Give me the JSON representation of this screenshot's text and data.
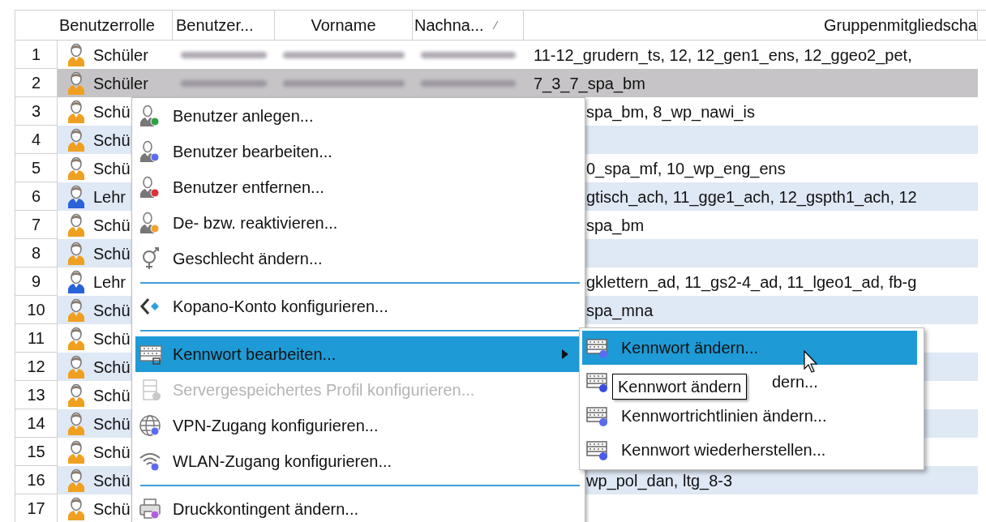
{
  "table": {
    "columns": [
      "Benutzerrolle",
      "Benutzer...",
      "Vorname",
      "Nachna...",
      "Gruppenmitgliedscha"
    ],
    "rows": [
      {
        "number": "1",
        "role": "Schüler",
        "color": "#f0a020",
        "selected": false,
        "redacted": true,
        "groups": "11-12_grudern_ts, 12, 12_gen1_ens, 12_ggeo2_pet,"
      },
      {
        "number": "2",
        "role": "Schüler",
        "color": "#f0a020",
        "selected": true,
        "redacted": true,
        "groups": "7_3_7_spa_bm"
      },
      {
        "number": "3",
        "role": "Schü",
        "color": "#f0a020",
        "selected": false,
        "groups": "spa_bm, 8_wp_nawi_is"
      },
      {
        "number": "4",
        "role": "Schü",
        "color": "#f0a020",
        "selected": false
      },
      {
        "number": "5",
        "role": "Schü",
        "color": "#f0a020",
        "selected": false,
        "groups": "0_spa_mf, 10_wp_eng_ens"
      },
      {
        "number": "6",
        "role": "Lehr",
        "color": "#2a62d8",
        "selected": false,
        "groups": "gtisch_ach, 11_gge1_ach, 12_gspth1_ach, 12"
      },
      {
        "number": "7",
        "role": "Schü",
        "color": "#f0a020",
        "selected": false,
        "groups": "spa_bm"
      },
      {
        "number": "8",
        "role": "Schü",
        "color": "#f0a020",
        "selected": false
      },
      {
        "number": "9",
        "role": "Lehr",
        "color": "#2a62d8",
        "selected": false,
        "groups": "gklettern_ad, 11_gs2-4_ad, 11_lgeo1_ad, fb-g"
      },
      {
        "number": "10",
        "role": "Schü",
        "color": "#f0a020",
        "selected": false,
        "groups": "spa_mna"
      },
      {
        "number": "11",
        "role": "Schü",
        "color": "#f0a020",
        "selected": false
      },
      {
        "number": "12",
        "role": "Schü",
        "color": "#f0a020",
        "selected": false
      },
      {
        "number": "13",
        "role": "Schü",
        "color": "#f0a020",
        "selected": false
      },
      {
        "number": "14",
        "role": "Schü",
        "color": "#f0a020",
        "selected": false
      },
      {
        "number": "15",
        "role": "Schü",
        "color": "#f0a020",
        "selected": false
      },
      {
        "number": "16",
        "role": "Schü",
        "color": "#f0a020",
        "selected": false,
        "groups": "wp_pol_dan, ltg_8-3"
      },
      {
        "number": "17",
        "role": "Schü",
        "color": "#f0a020",
        "selected": false
      }
    ]
  },
  "context_menu": {
    "items": [
      {
        "kind": "user-add",
        "label": "Benutzer anlegen...",
        "selected": false,
        "disabled": false,
        "submenu": false
      },
      {
        "kind": "user-edit",
        "label": "Benutzer bearbeiten...",
        "selected": false,
        "disabled": false,
        "submenu": false
      },
      {
        "kind": "user-remove",
        "label": "Benutzer entfernen...",
        "selected": false,
        "disabled": false,
        "submenu": false
      },
      {
        "kind": "user-toggle",
        "label": "De- bzw. reaktivieren...",
        "selected": false,
        "disabled": false,
        "submenu": false
      },
      {
        "kind": "gender",
        "label": "Geschlecht ändern...",
        "selected": false,
        "disabled": false,
        "submenu": false
      },
      {
        "kind": "separator"
      },
      {
        "kind": "kopano",
        "label": "Kopano-Konto konfigurieren...",
        "selected": false,
        "disabled": false,
        "submenu": false
      },
      {
        "kind": "separator"
      },
      {
        "kind": "password",
        "label": "Kennwort bearbeiten...",
        "selected": true,
        "disabled": false,
        "submenu": true
      },
      {
        "kind": "server",
        "label": "Servergespeichertes Profil konfigurieren...",
        "selected": false,
        "disabled": true,
        "submenu": false
      },
      {
        "kind": "globe",
        "label": "VPN-Zugang konfigurieren...",
        "selected": false,
        "disabled": false,
        "submenu": false
      },
      {
        "kind": "wifi",
        "label": "WLAN-Zugang konfigurieren...",
        "selected": false,
        "disabled": false,
        "submenu": false
      },
      {
        "kind": "separator"
      },
      {
        "kind": "printer",
        "label": "Druckkontingent ändern...",
        "selected": false,
        "disabled": false,
        "submenu": false
      }
    ]
  },
  "submenu": {
    "items": [
      {
        "label": "Kennwort ändern...",
        "selected": true
      },
      {
        "label": "dern...",
        "selected": false
      },
      {
        "label": "Kennwortrichtlinien ändern...",
        "selected": false
      },
      {
        "label": "Kennwort wiederherstellen...",
        "selected": false
      }
    ]
  },
  "tooltip": {
    "text": "Kennwort ändern"
  }
}
